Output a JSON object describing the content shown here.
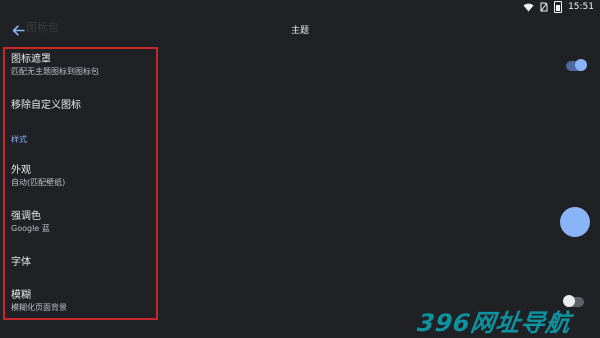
{
  "status": {
    "time": "15:51"
  },
  "background_title": "图标包",
  "header": {
    "title": "主题"
  },
  "settings": {
    "icon_mask": {
      "title": "图标遮罩",
      "summary": "匹配无主题图标到图标包"
    },
    "remove_custom_icons": {
      "title": "移除自定义图标"
    },
    "section_style": "样式",
    "appearance": {
      "title": "外观",
      "summary": "自动(匹配壁纸)"
    },
    "accent_color": {
      "title": "强调色",
      "summary": "Google 蓝"
    },
    "font": {
      "title": "字体"
    },
    "blur": {
      "title": "模糊",
      "summary": "模糊化页面背景"
    }
  },
  "watermark": "396网址导航",
  "colors": {
    "accent": "#8ab4f8",
    "highlight_border": "#c7262b",
    "watermark": "#0c9aa7"
  }
}
